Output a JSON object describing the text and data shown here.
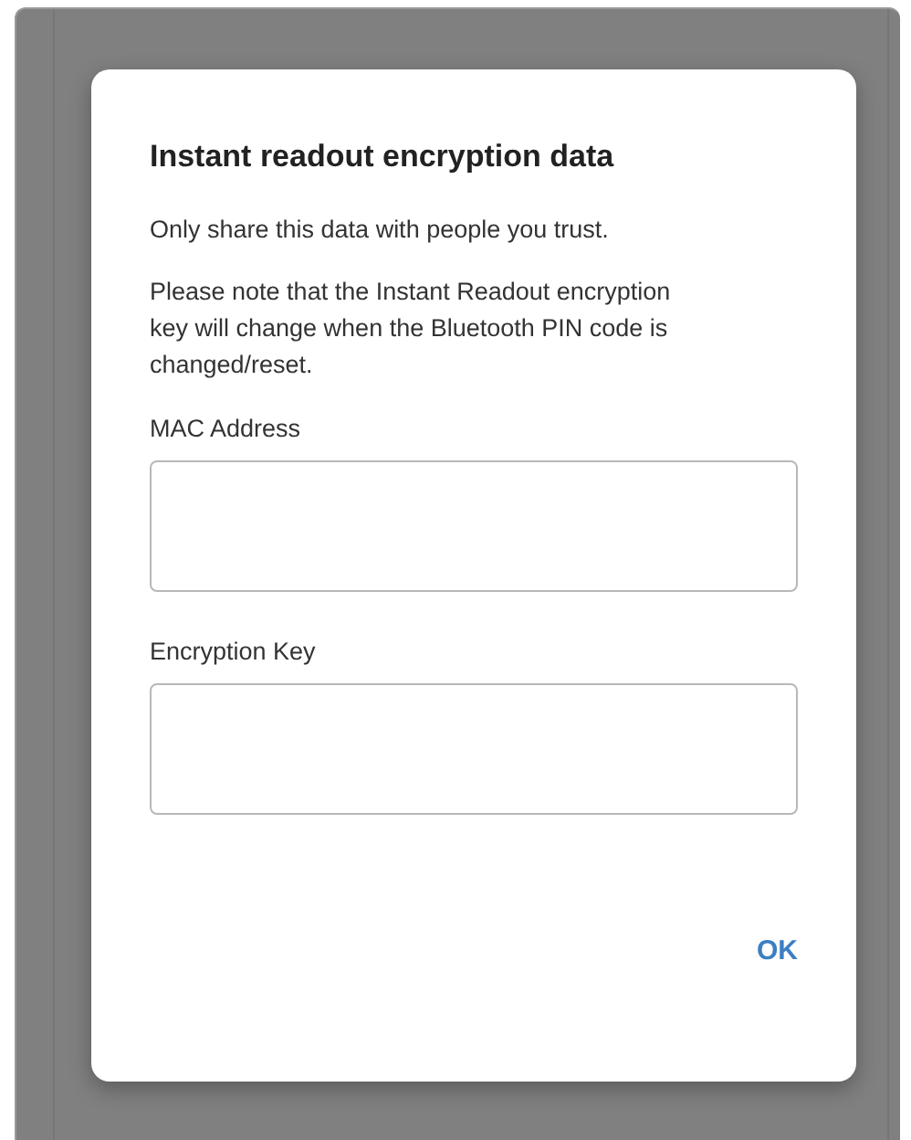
{
  "dialog": {
    "title": "Instant readout encryption data",
    "paragraphs": [
      "Only share this data with people you trust.",
      "Please note that the Instant Readout encryption key will change when the Bluetooth PIN code is changed/reset."
    ],
    "fields": [
      {
        "label": "MAC Address"
      },
      {
        "label": "Encryption Key"
      }
    ],
    "button": "OK"
  }
}
